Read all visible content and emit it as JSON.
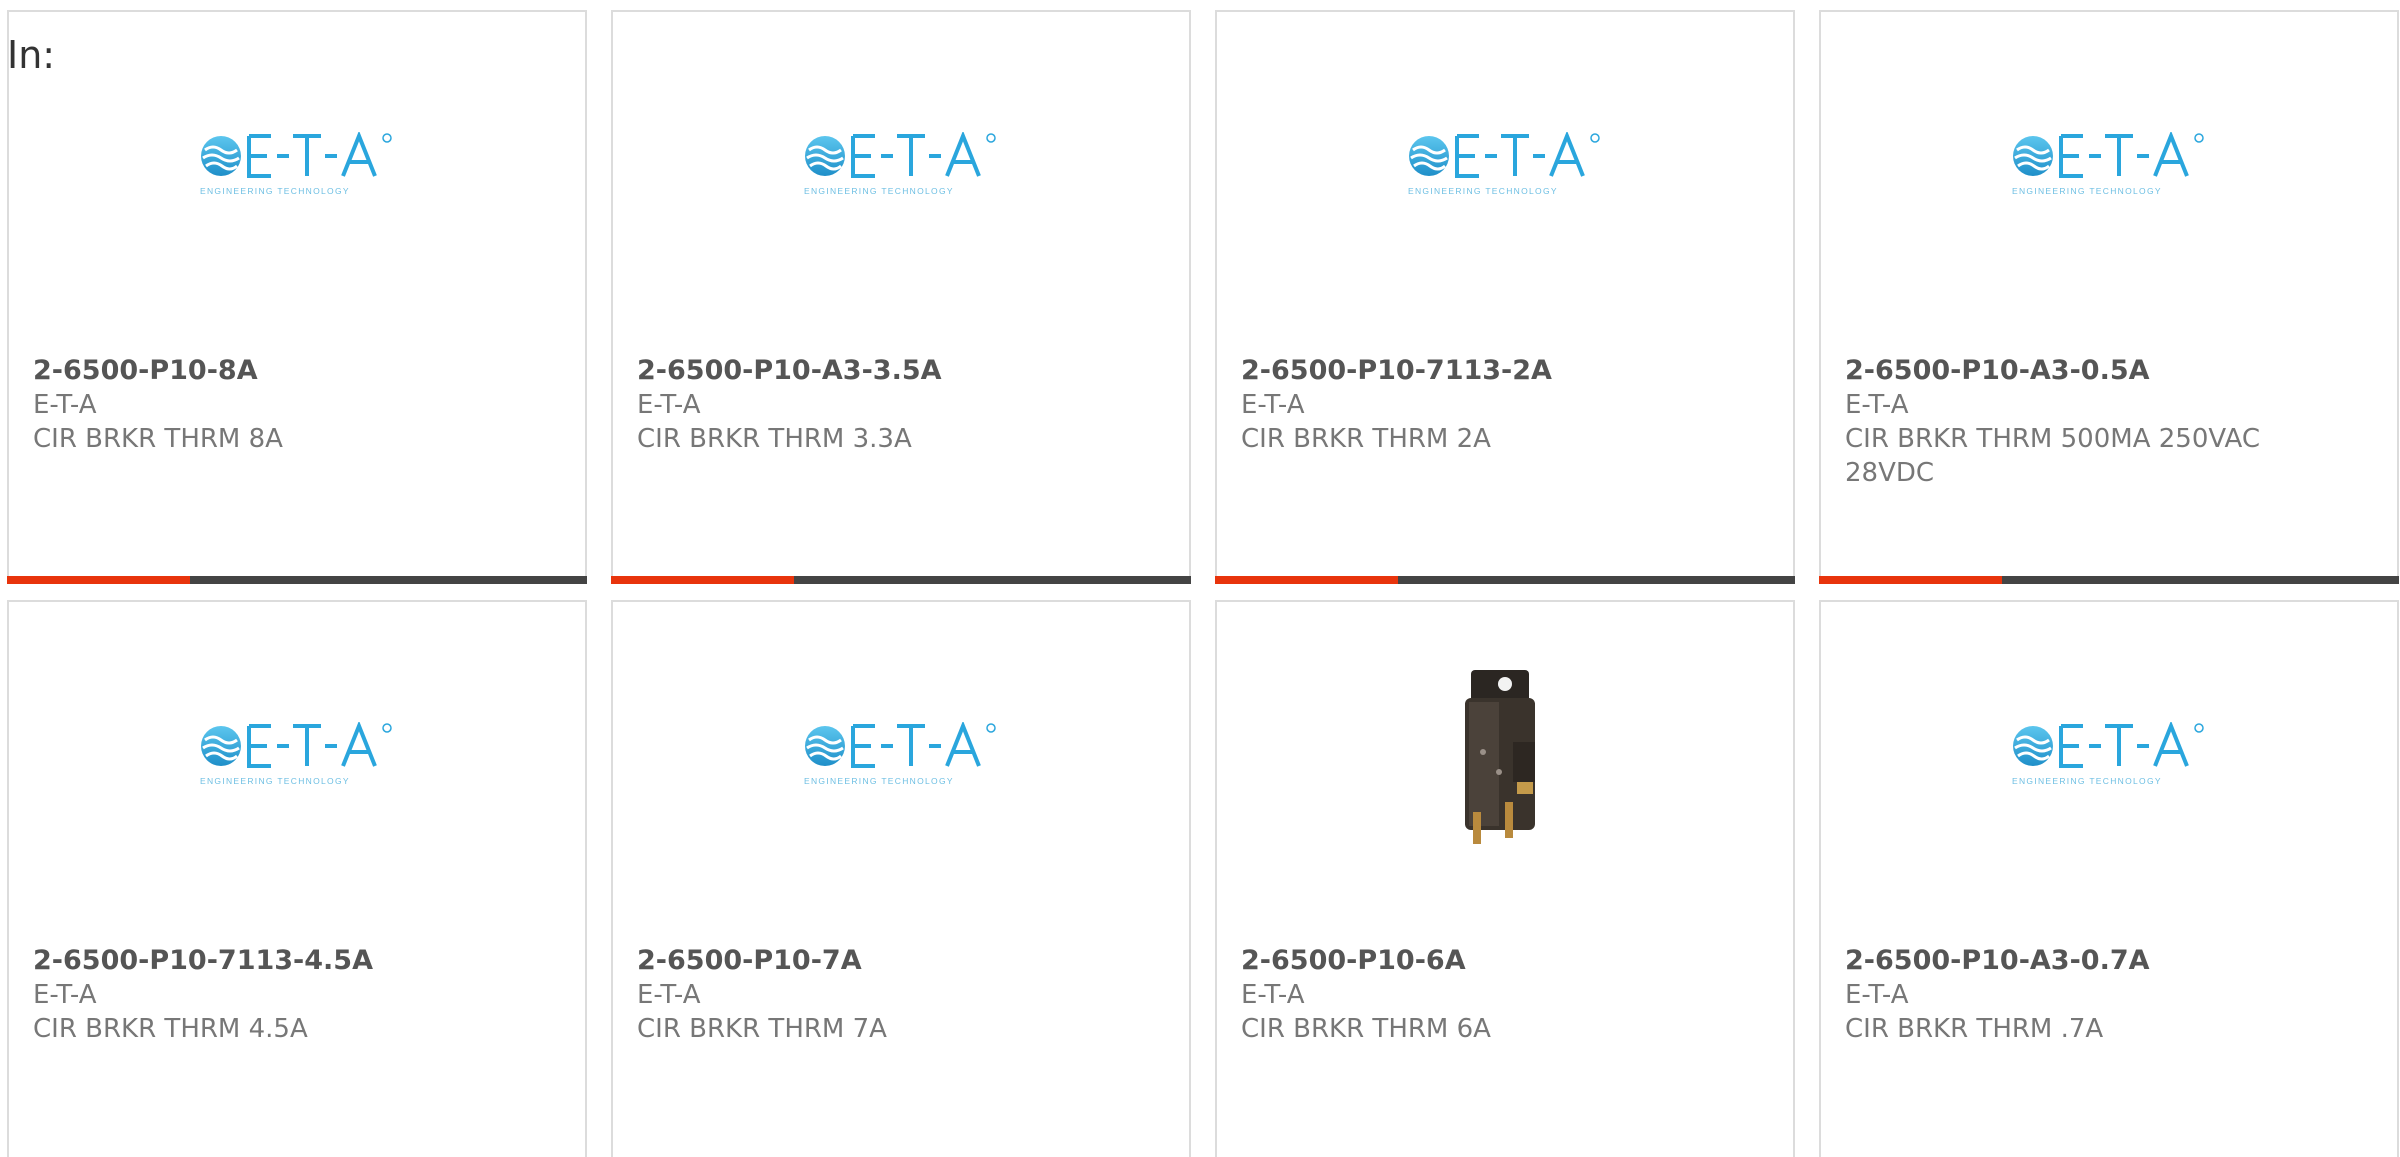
{
  "header": {
    "label": "In:"
  },
  "colors": {
    "accent": "#e8340c",
    "bar": "#444444",
    "logo_blue": "#2aa6dd"
  },
  "products": [
    {
      "part": "2-6500-P10-8A",
      "brand": "E-T-A",
      "desc": "CIR BRKR THRM 8A",
      "image": "eta-logo"
    },
    {
      "part": "2-6500-P10-A3-3.5A",
      "brand": "E-T-A",
      "desc": "CIR BRKR THRM 3.3A",
      "image": "eta-logo"
    },
    {
      "part": "2-6500-P10-7113-2A",
      "brand": "E-T-A",
      "desc": "CIR BRKR THRM 2A",
      "image": "eta-logo"
    },
    {
      "part": "2-6500-P10-A3-0.5A",
      "brand": "E-T-A",
      "desc": "CIR BRKR THRM 500MA 250VAC 28VDC",
      "image": "eta-logo"
    },
    {
      "part": "2-6500-P10-7113-4.5A",
      "brand": "E-T-A",
      "desc": "CIR BRKR THRM 4.5A",
      "image": "eta-logo"
    },
    {
      "part": "2-6500-P10-7A",
      "brand": "E-T-A",
      "desc": "CIR BRKR THRM 7A",
      "image": "eta-logo"
    },
    {
      "part": "2-6500-P10-6A",
      "brand": "E-T-A",
      "desc": "CIR BRKR THRM 6A",
      "image": "breaker-photo"
    },
    {
      "part": "2-6500-P10-A3-0.7A",
      "brand": "E-T-A",
      "desc": "CIR BRKR THRM .7A",
      "image": "eta-logo"
    }
  ],
  "logo": {
    "text": "E-T-A",
    "tagline": "ENGINEERING TECHNOLOGY"
  }
}
